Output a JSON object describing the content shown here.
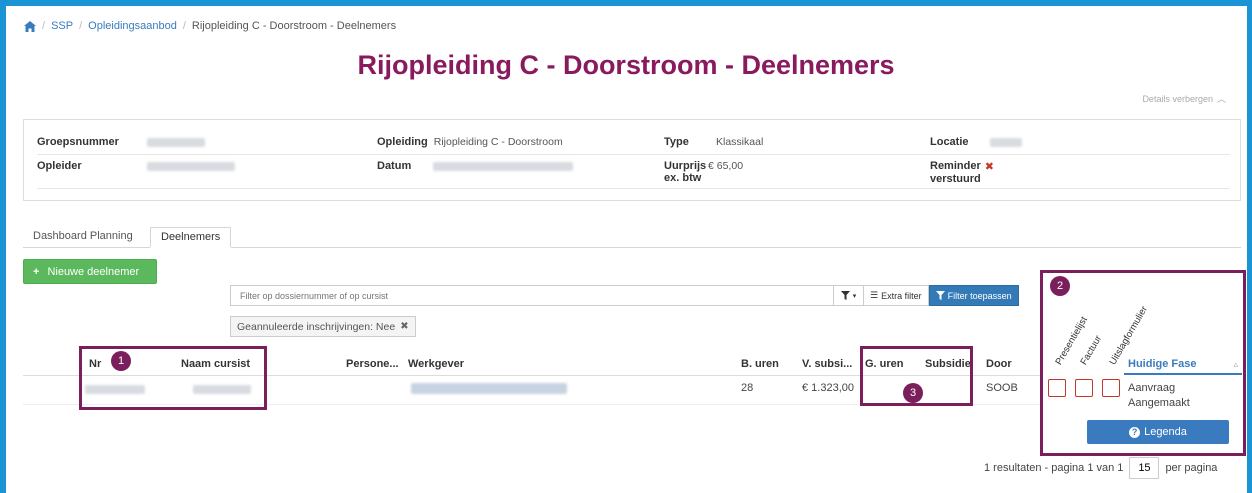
{
  "breadcrumb": {
    "items": [
      "SSP",
      "Opleidingsaanbod"
    ],
    "current": "Rijopleiding C - Doorstroom - Deelnemers"
  },
  "page": {
    "title": "Rijopleiding C - Doorstroom - Deelnemers",
    "details_toggle": "Details verbergen"
  },
  "info": {
    "groepsnummer_label": "Groepsnummer",
    "opleider_label": "Opleider",
    "opleiding_label": "Opleiding",
    "opleiding_value": "Rijopleiding C - Doorstroom",
    "datum_label": "Datum",
    "type_label": "Type",
    "type_value": "Klassikaal",
    "uurprijs_label_1": "Uurprijs",
    "uurprijs_label_2": "ex. btw",
    "uurprijs_value": "€ 65,00",
    "locatie_label": "Locatie",
    "reminder_label_1": "Reminder",
    "reminder_label_2": "verstuurd"
  },
  "tabs": [
    {
      "label": "Dashboard Planning",
      "active": false
    },
    {
      "label": "Deelnemers",
      "active": true
    }
  ],
  "toolbar": {
    "new_button": "Nieuwe deelnemer",
    "search_placeholder": "Filter op dossiernummer of op cursist",
    "extra_filter": "Extra filter",
    "apply_filter": "Filter toepassen",
    "chip": "Geannuleerde inschrijvingen: Nee"
  },
  "table": {
    "headers": {
      "nr": "Nr",
      "naam": "Naam cursist",
      "persone": "Persone...",
      "werkgever": "Werkgever",
      "b_uren": "B. uren",
      "v_subsi": "V. subsi...",
      "g_uren": "G. uren",
      "subsidie": "Subsidie",
      "door": "Door",
      "presentielijst": "Presentielijst",
      "factuur": "Factuur",
      "uitslagformulier": "Uitslagformulier",
      "huidige_fase": "Huidige Fase"
    },
    "row": {
      "b_uren": "28",
      "v_subsi": "€ 1.323,00",
      "door": "SOOB",
      "fase_1": "Aanvraag",
      "fase_2": "Aangemaakt"
    }
  },
  "legend_button": "Legenda",
  "pagination": {
    "summary": "1 resultaten - pagina 1 van 1",
    "per_page_value": "15",
    "per_page_label": "per pagina"
  },
  "annotations": {
    "b1": "1",
    "b2": "2",
    "b3": "3"
  },
  "colors": {
    "accent": "#8a1a5e",
    "annotation": "#7a1f5c",
    "primary": "#337ab7",
    "success": "#5cb85c",
    "danger": "#c0392b",
    "frame": "#1a94d4"
  }
}
